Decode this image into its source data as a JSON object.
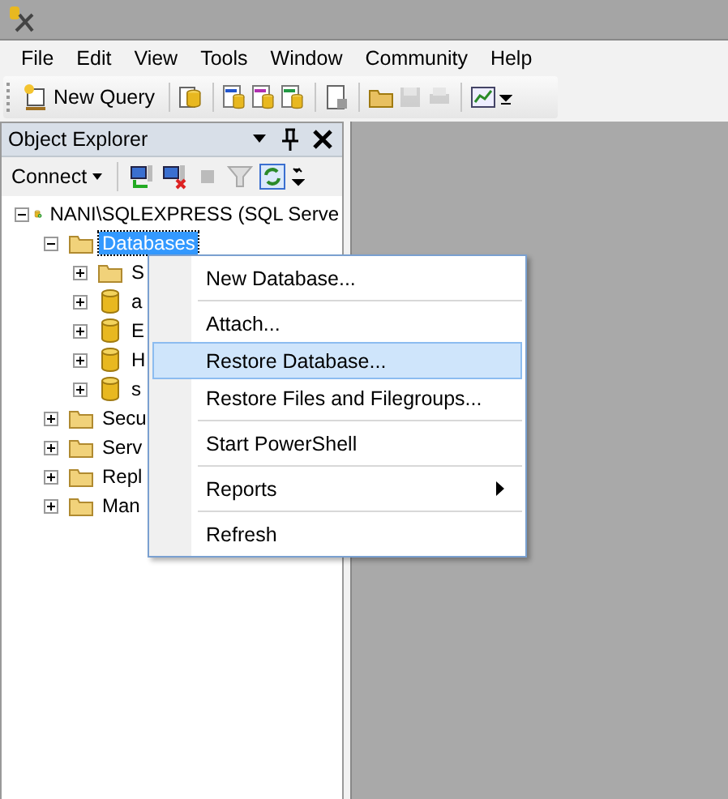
{
  "menu_bar": [
    "File",
    "Edit",
    "View",
    "Tools",
    "Window",
    "Community",
    "Help"
  ],
  "toolbar": {
    "new_query": "New Query"
  },
  "object_explorer": {
    "title": "Object Explorer",
    "connect": "Connect",
    "tree": [
      {
        "label": "NANI\\SQLEXPRESS (SQL Serve",
        "kind": "server",
        "expanded": true,
        "selected": false,
        "children": [
          {
            "label": "Databases",
            "kind": "folder",
            "expanded": true,
            "selected": true,
            "children": [
              {
                "label": "S",
                "kind": "folder",
                "expanded": false,
                "selected": false
              },
              {
                "label": "a",
                "kind": "database",
                "expanded": false,
                "selected": false
              },
              {
                "label": "E",
                "kind": "database",
                "expanded": false,
                "selected": false
              },
              {
                "label": "H",
                "kind": "database",
                "expanded": false,
                "selected": false
              },
              {
                "label": "s",
                "kind": "database",
                "expanded": false,
                "selected": false
              }
            ]
          },
          {
            "label": "Secu",
            "kind": "folder",
            "expanded": false,
            "selected": false
          },
          {
            "label": "Serv",
            "kind": "folder",
            "expanded": false,
            "selected": false
          },
          {
            "label": "Repl",
            "kind": "folder",
            "expanded": false,
            "selected": false
          },
          {
            "label": "Man",
            "kind": "folder",
            "expanded": false,
            "selected": false
          }
        ]
      }
    ]
  },
  "context_menu": [
    {
      "label": "New Database...",
      "selected": false,
      "submenu": false,
      "separator_after": true
    },
    {
      "label": "Attach...",
      "selected": false,
      "submenu": false,
      "separator_after": false
    },
    {
      "label": "Restore Database...",
      "selected": true,
      "submenu": false,
      "separator_after": false
    },
    {
      "label": "Restore Files and Filegroups...",
      "selected": false,
      "submenu": false,
      "separator_after": true
    },
    {
      "label": "Start PowerShell",
      "selected": false,
      "submenu": false,
      "separator_after": true
    },
    {
      "label": "Reports",
      "selected": false,
      "submenu": true,
      "separator_after": true
    },
    {
      "label": "Refresh",
      "selected": false,
      "submenu": false,
      "separator_after": false
    }
  ]
}
